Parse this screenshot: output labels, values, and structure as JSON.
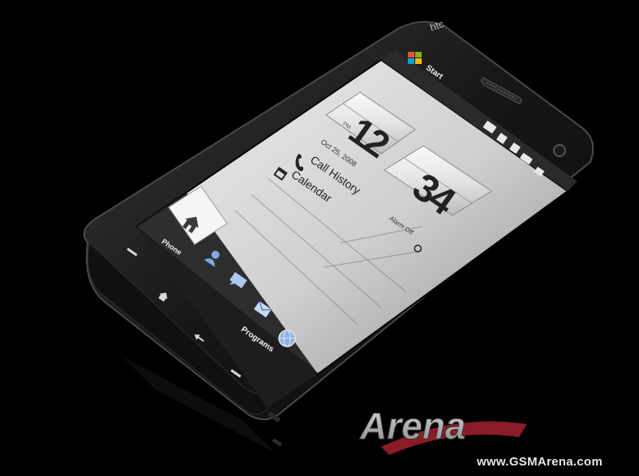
{
  "brand": {
    "label": "htc"
  },
  "screen": {
    "start_label": "Start",
    "clock": {
      "ampm": "PM",
      "hour": "12",
      "minute": "34",
      "alarm_label": "Alarm Off"
    },
    "date": "Oct 25, 2008",
    "menu": {
      "call_history": "Call History",
      "calendar": "Calendar"
    },
    "tabs": {
      "phone": "Phone",
      "programs": "Programs"
    }
  },
  "watermark": {
    "logo_text": "GSMArena",
    "url": "www.GSMArena.com"
  },
  "colors": {
    "background": "#000000",
    "phone_body": "#1a1a1a",
    "screen_bg": "#d9d9d9",
    "accent_red": "#a01c2a"
  },
  "icons": {
    "start": "windows-flag-icon",
    "home": "home-icon",
    "contacts": "person-icon",
    "messages": "speech-bubble-icon",
    "mail": "envelope-icon",
    "internet": "globe-icon",
    "call_history": "phone-handset-icon",
    "calendar": "calendar-icon",
    "alarm": "alarm-clock-icon",
    "call": "call-green-icon",
    "end": "call-end-icon",
    "home_key": "home-key-icon",
    "back": "back-arrow-icon"
  }
}
